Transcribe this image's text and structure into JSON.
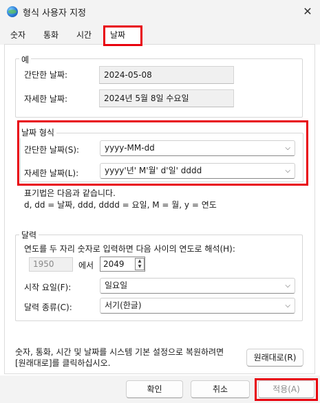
{
  "window": {
    "title": "형식 사용자 지정",
    "close_glyph": "✕"
  },
  "tabs": [
    "숫자",
    "통화",
    "시간",
    "날짜"
  ],
  "example_group": {
    "label": "예",
    "short_label": "간단한 날짜:",
    "short_value": "2024-05-08",
    "long_label": "자세한 날짜:",
    "long_value": "2024년 5월 8일 수요일"
  },
  "format_group": {
    "label": "날짜 형식",
    "short_label": "간단한 날짜(S):",
    "short_value": "yyyy-MM-dd",
    "long_label": "자세한 날짜(L):",
    "long_value": "yyyy'년' M'월' d'일' dddd"
  },
  "notation": {
    "line1": "표기법은 다음과 같습니다.",
    "line2": "d, dd = 날짜,  ddd, dddd = 요일,  M = 월,  y = 연도"
  },
  "calendar_group": {
    "label": "달력",
    "two_digit_text": "연도를 두 자리 숫자로 입력하면 다음 사이의 연도로 해석(H):",
    "year_from": "1950",
    "between_text": "에서",
    "year_to": "2049",
    "first_day_label": "시작 요일(F):",
    "first_day_value": "일요일",
    "calendar_type_label": "달력 종류(C):",
    "calendar_type_value": "서기(한글)"
  },
  "reset": {
    "line1": "숫자, 통화, 시간 및 날짜를 시스템 기본 설정으로 복원하려면",
    "line2": "[원래대로]를 클릭하십시오.",
    "button": "원래대로(R)"
  },
  "footer": {
    "ok": "확인",
    "cancel": "취소",
    "apply": "적용(A)"
  },
  "colors": {
    "highlight": "#e8000d",
    "chrome": "#f3f3f3"
  },
  "icons": {
    "dropdown": "chevron-down-icon",
    "spin_up": "▲",
    "spin_down": "▼",
    "chevron": "⌵"
  }
}
